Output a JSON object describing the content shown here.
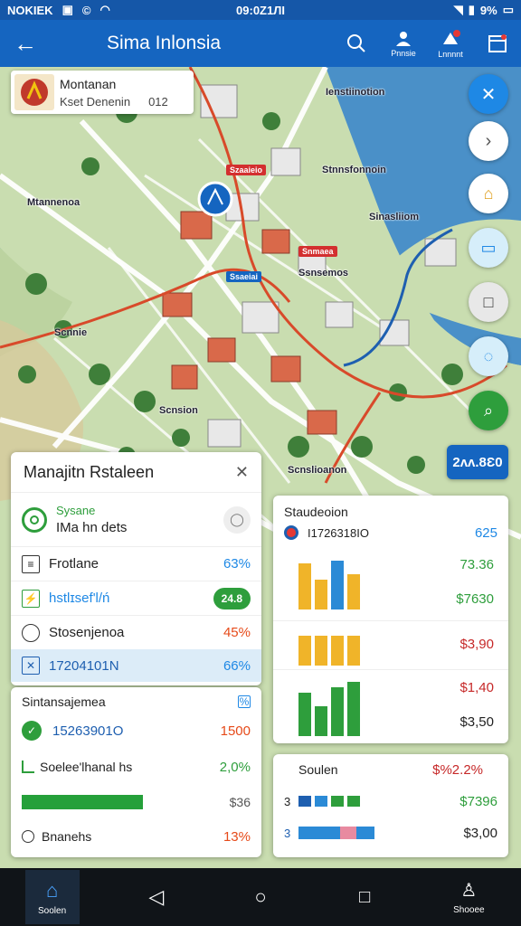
{
  "status_bar": {
    "carrier": "NOKIEK",
    "time": "09:0Z1ЛI",
    "battery": "9%"
  },
  "app_bar": {
    "title": "Sima Inlonsia",
    "actions": [
      {
        "icon": "search-icon",
        "label": ""
      },
      {
        "icon": "person-alert-icon",
        "label": "Pnnsie"
      },
      {
        "icon": "notification-icon",
        "label": "Lnnnnt"
      },
      {
        "icon": "calendar-icon",
        "label": ""
      }
    ]
  },
  "map": {
    "info_chip": {
      "title": "Montanan",
      "subtitle": "Kset Denenin",
      "code": "012"
    },
    "labels": [
      "Ienstiinotion",
      "Stnnsfonnoin",
      "Sinasliiom",
      "Mtannenoa",
      "Scnnie",
      "Ssnsemos",
      "Scnsion",
      "Scnslioanon"
    ],
    "chips": [
      {
        "text": "Szaaieio",
        "color": "#d32f2f"
      },
      {
        "text": "Snmaea",
        "color": "#d32f2f"
      },
      {
        "text": "Ssaeiai",
        "color": "#1565c0"
      }
    ],
    "zoom_label": "2ʌʌ.8Ɛ0",
    "colors": {
      "water": "#4a90c8",
      "land": "#c9ddb0",
      "road": "#ffffff",
      "route_red": "#d84a2a",
      "route_blue": "#1e5fb0"
    }
  },
  "panel_left": {
    "title": "Manajitn Rstaleen",
    "rows": [
      {
        "icon": "status-circle-icon",
        "label": "Sysane",
        "sub": "IMa hn dets",
        "value": ""
      },
      {
        "icon": "profile-icon",
        "label": "Frotlane",
        "value": "63%"
      },
      {
        "icon": "chart-icon",
        "label": "hstlɪsef'l/ń",
        "value": "24.8"
      },
      {
        "icon": "shield-icon",
        "label": "Stosenjenoa",
        "value": "45%"
      },
      {
        "icon": "task-icon",
        "label": "17204101N",
        "value": "66%"
      }
    ]
  },
  "panel_left_2": {
    "title": "Sintansajemea",
    "rows": [
      {
        "icon": "check-icon",
        "label": "15263901O",
        "value": "1500"
      },
      {
        "icon": "chart-icon",
        "label": "Soelee'lhanal hs",
        "value": "2,0%"
      },
      {
        "icon": "progress-icon",
        "label": "",
        "value": "$36",
        "progress": 0.62
      },
      {
        "icon": "tag-icon",
        "label": "Bnanehs",
        "value": "13%"
      }
    ]
  },
  "panel_right": {
    "title": "Staudeoion",
    "header_value": "I1726318IO",
    "header_amount": "625",
    "amounts": [
      "73.36",
      "$7630",
      "$3,90",
      "$1,40",
      "$3,50"
    ],
    "chart_data": [
      {
        "type": "bar",
        "series": [
          {
            "color": "#f0b429",
            "values": [
              0.85,
              0.55
            ]
          },
          {
            "color": "#2b8ad6",
            "values": [
              0.9,
              0.6
            ]
          }
        ]
      }
    ]
  },
  "panel_right_2": {
    "title": "Soulen",
    "header_amount": "$%2.2%",
    "rows": [
      {
        "prefix": "3",
        "amount": "$7396"
      },
      {
        "prefix": "3",
        "amount": "$3,00"
      }
    ]
  },
  "bottom_nav": {
    "items": [
      {
        "icon": "home-icon",
        "label": "Soolen"
      },
      {
        "icon": "back-icon",
        "label": ""
      },
      {
        "icon": "home-circle-icon",
        "label": ""
      },
      {
        "icon": "recents-icon",
        "label": ""
      },
      {
        "icon": "profile-icon",
        "label": "Shooee"
      }
    ]
  }
}
